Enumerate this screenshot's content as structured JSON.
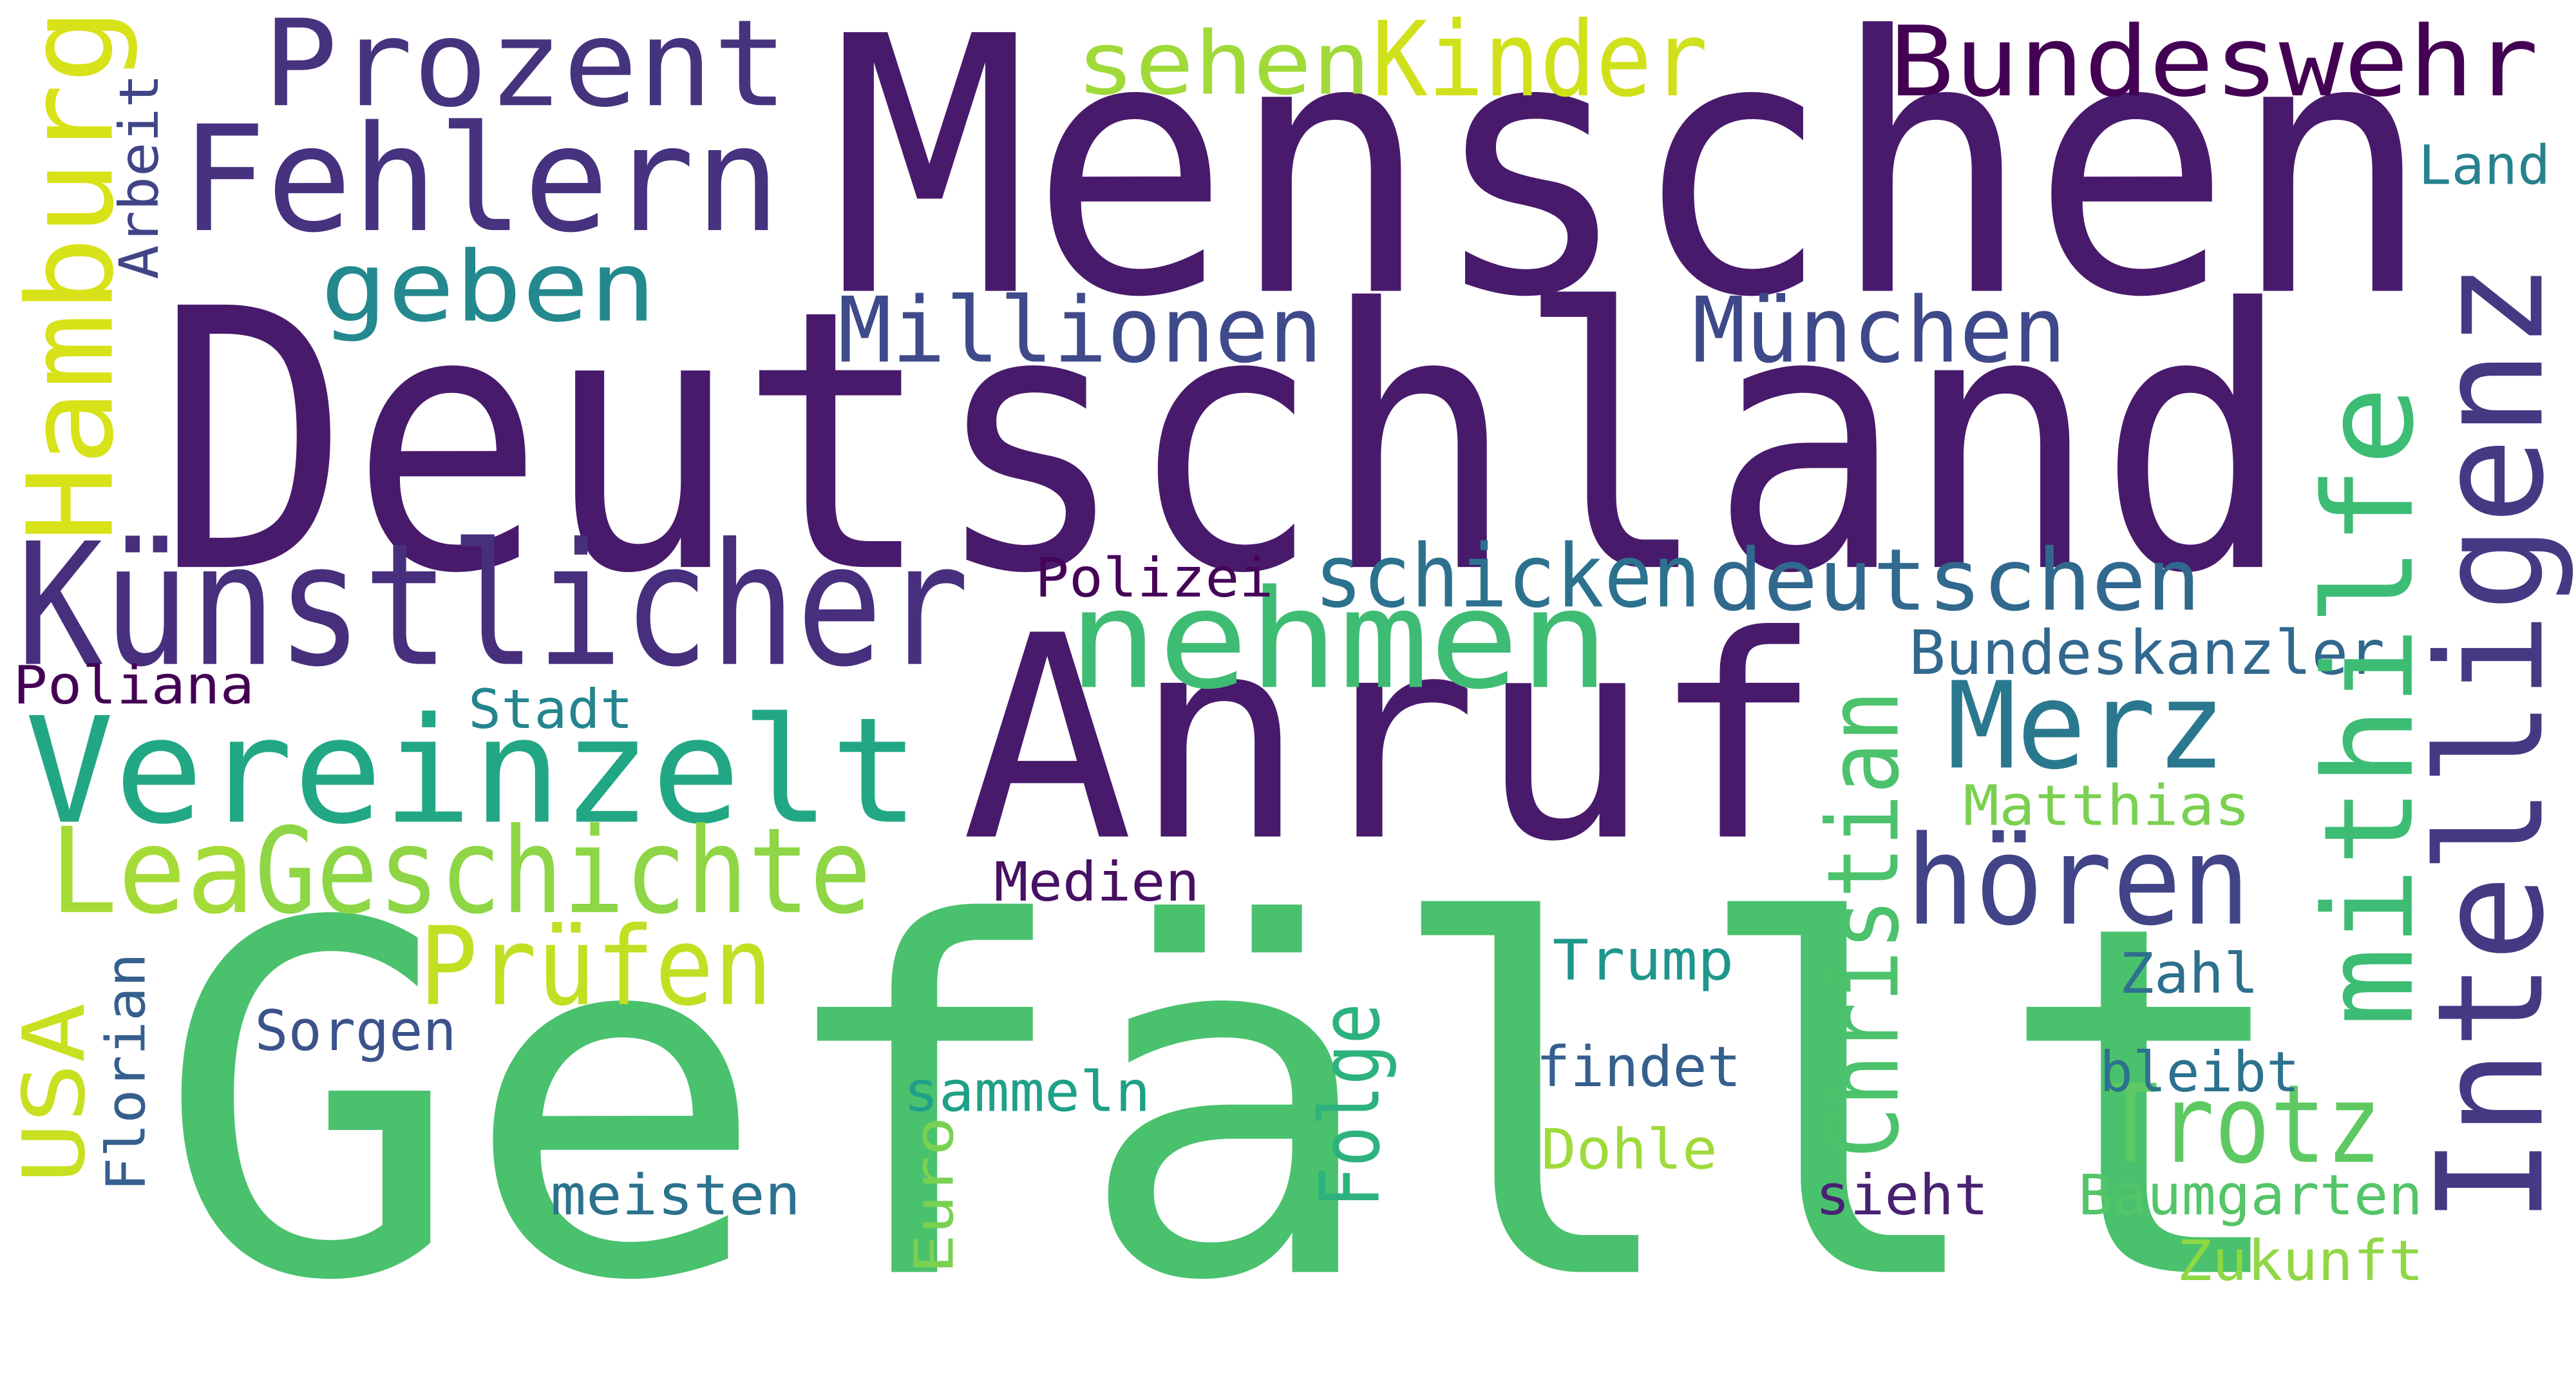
{
  "words": [
    {
      "text": "Menschen",
      "color": "#481a6c",
      "rotated": false
    },
    {
      "text": "Deutschland",
      "color": "#481a6c",
      "rotated": false
    },
    {
      "text": "Gefällt",
      "color": "#4ac16d",
      "rotated": false
    },
    {
      "text": "Anruf",
      "color": "#481a6c",
      "rotated": false
    },
    {
      "text": "Künstlicher",
      "color": "#472f7d",
      "rotated": false
    },
    {
      "text": "Fehlern",
      "color": "#46327e",
      "rotated": false
    },
    {
      "text": "Prozent",
      "color": "#46337e",
      "rotated": false
    },
    {
      "text": "Kinder",
      "color": "#d0e11c",
      "rotated": false
    },
    {
      "text": "sehen",
      "color": "#a0da39",
      "rotated": false
    },
    {
      "text": "Bundeswehr",
      "color": "#440154",
      "rotated": false
    },
    {
      "text": "Land",
      "color": "#26828e",
      "rotated": false
    },
    {
      "text": "geben",
      "color": "#23898e",
      "rotated": false
    },
    {
      "text": "Millionen",
      "color": "#3e4a89",
      "rotated": false
    },
    {
      "text": "München",
      "color": "#3e4989",
      "rotated": false
    },
    {
      "text": "schicken",
      "color": "#2c728e",
      "rotated": false
    },
    {
      "text": "deutschen",
      "color": "#31688e",
      "rotated": false
    },
    {
      "text": "nehmen",
      "color": "#3fbc73",
      "rotated": false
    },
    {
      "text": "Polizei",
      "color": "#450457",
      "rotated": false
    },
    {
      "text": "Bundeskanzler",
      "color": "#31688e",
      "rotated": false
    },
    {
      "text": "Poliana",
      "color": "#440154",
      "rotated": false
    },
    {
      "text": "Stadt",
      "color": "#25858e",
      "rotated": false
    },
    {
      "text": "Vereinzelt",
      "color": "#22a785",
      "rotated": false
    },
    {
      "text": "Merz",
      "color": "#2a788e",
      "rotated": false
    },
    {
      "text": "hören",
      "color": "#414487",
      "rotated": false
    },
    {
      "text": "Matthias",
      "color": "#7ad151",
      "rotated": false
    },
    {
      "text": "Lea",
      "color": "#a5db36",
      "rotated": false
    },
    {
      "text": "Geschichte",
      "color": "#8ed645",
      "rotated": false
    },
    {
      "text": "Medien",
      "color": "#471063",
      "rotated": false
    },
    {
      "text": "Prüfen",
      "color": "#c2df23",
      "rotated": false
    },
    {
      "text": "Trump",
      "color": "#1f968b",
      "rotated": false
    },
    {
      "text": "Zahl",
      "color": "#2d708e",
      "rotated": false
    },
    {
      "text": "Sorgen",
      "color": "#3b528b",
      "rotated": false
    },
    {
      "text": "findet",
      "color": "#355f8d",
      "rotated": false
    },
    {
      "text": "Trotz",
      "color": "#5ec962",
      "rotated": false
    },
    {
      "text": "bleibt",
      "color": "#2c728e",
      "rotated": false
    },
    {
      "text": "sammeln",
      "color": "#1fa088",
      "rotated": false
    },
    {
      "text": "Dohle",
      "color": "#9fda3a",
      "rotated": false
    },
    {
      "text": "meisten",
      "color": "#2c728e",
      "rotated": false
    },
    {
      "text": "sieht",
      "color": "#482173",
      "rotated": false
    },
    {
      "text": "Baumgarten",
      "color": "#54c568",
      "rotated": false
    },
    {
      "text": "Zukunft",
      "color": "#8fd744",
      "rotated": false
    },
    {
      "text": "Hamburg",
      "color": "#d8e219",
      "rotated": true
    },
    {
      "text": "Arbeit",
      "color": "#414487",
      "rotated": true
    },
    {
      "text": "USA",
      "color": "#c8e020",
      "rotated": true
    },
    {
      "text": "Florian",
      "color": "#355f8d",
      "rotated": true
    },
    {
      "text": "Euro",
      "color": "#7ad151",
      "rotated": true
    },
    {
      "text": "Folge",
      "color": "#2db27d",
      "rotated": true
    },
    {
      "text": "Christian",
      "color": "#4cc26c",
      "rotated": true
    },
    {
      "text": "mithilfe",
      "color": "#3dbc74",
      "rotated": true
    },
    {
      "text": "Intelligenz",
      "color": "#443983",
      "rotated": true
    }
  ]
}
